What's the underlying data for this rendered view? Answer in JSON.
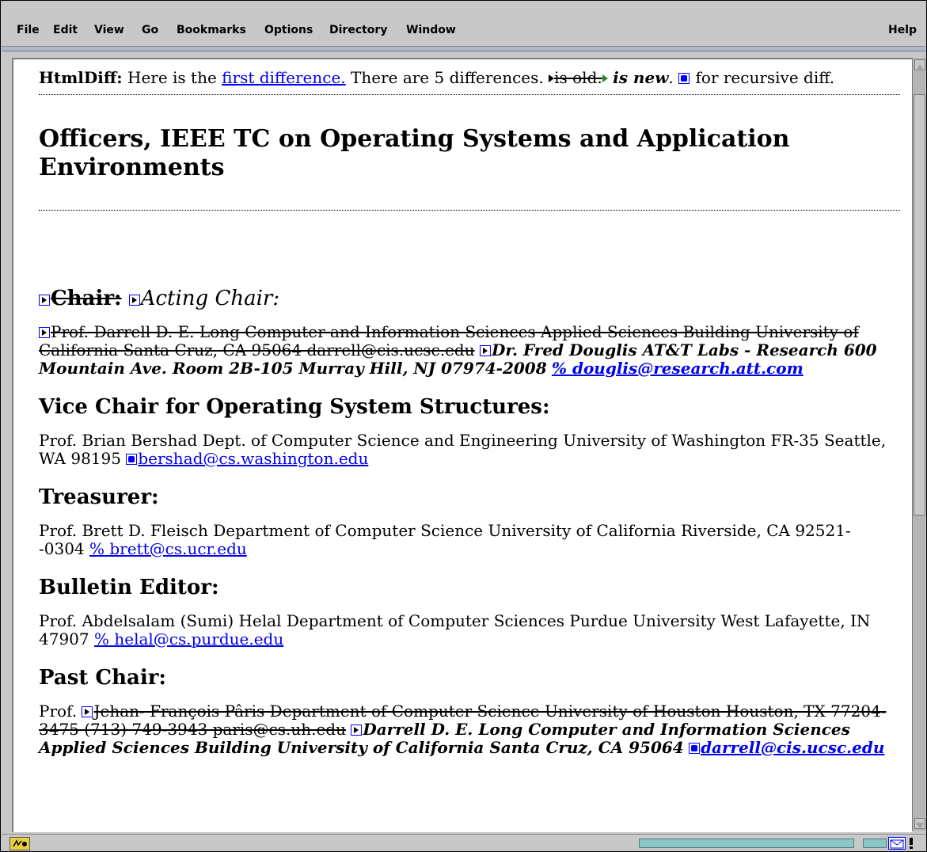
{
  "menubar": {
    "items": [
      "File",
      "Edit",
      "View",
      "Go",
      "Bookmarks",
      "Options",
      "Directory",
      "Window"
    ],
    "help": "Help"
  },
  "diff_banner": {
    "label": "HtmlDiff:",
    "text1": "Here is the",
    "link": "first difference.",
    "text2": "There are 5 differences.",
    "old_label": "is old.",
    "new_label": "is new",
    "text3": "for recursive diff."
  },
  "page": {
    "title": "Officers, IEEE TC on Operating Systems and Application Environments",
    "chair": {
      "old_heading": "Chair:",
      "new_heading": "Acting Chair:",
      "old_text": "Prof. Darrell D. E. Long Computer and Information Sciences Applied Sciences Building University of California Santa Cruz, CA 95064 darrell@cis.ucsc.edu",
      "new_text": "Dr. Fred Douglis AT&T Labs - Research 600 Mountain Ave. Room 2B-105 Murray Hill, NJ 07974-2008",
      "new_email": "% douglis@research.att.com"
    },
    "vice_chair": {
      "heading": "Vice Chair for Operating System Structures:",
      "text": "Prof. Brian Bershad Dept. of Computer Science and Engineering University of Washington FR-35 Seattle, WA 98195",
      "email": "bershad@cs.washington.edu"
    },
    "treasurer": {
      "heading": "Treasurer:",
      "text": "Prof. Brett D. Fleisch Department of Computer Science University of California Riverside, CA 92521--0304",
      "email": "% brett@cs.ucr.edu"
    },
    "bulletin_editor": {
      "heading": "Bulletin Editor:",
      "text": "Prof. Abdelsalam (Sumi) Helal Department of Computer Sciences Purdue University West Lafayette, IN 47907",
      "email": "% helal@cs.purdue.edu"
    },
    "past_chair": {
      "heading": "Past Chair:",
      "prefix": "Prof.",
      "old_text": "Jehan- François Pâris Department of Computer Science University of Houston Houston, TX 77204-3475 (713) 749-3943 paris@cs.uh.edu",
      "new_text": "Darrell D. E. Long Computer and Information Sciences Applied Sciences Building University of California Santa Cruz, CA 95064",
      "new_email": "darrell@cis.ucsc.edu"
    }
  }
}
